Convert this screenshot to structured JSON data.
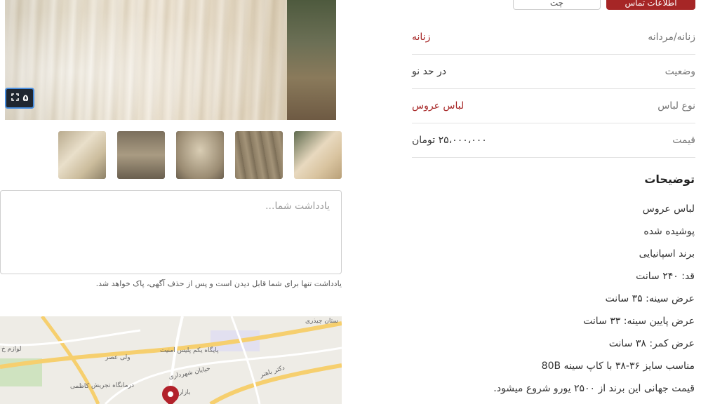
{
  "actions": {
    "chat_label": "چت",
    "contact_label": "اطلاعات تماس"
  },
  "gallery": {
    "photo_count": "۵",
    "main_image_icon": "expand-icon",
    "thumbnails": [
      "thumb-1",
      "thumb-2",
      "thumb-3",
      "thumb-4",
      "thumb-5"
    ]
  },
  "attributes": [
    {
      "key": "زنانه/مردانه",
      "value": "زنانه",
      "is_link": true
    },
    {
      "key": "وضعیت",
      "value": "در حد نو",
      "is_link": false
    },
    {
      "key": "نوع لباس",
      "value": "لباس عروس",
      "is_link": true
    },
    {
      "key": "قیمت",
      "value": "۲۵،۰۰۰،۰۰۰ تومان",
      "is_link": false
    }
  ],
  "description": {
    "title": "توضیحات",
    "lines": [
      "لباس عروس",
      "پوشیده شده",
      "برند اسپانیایی",
      "قد: ۲۴۰ سانت",
      "عرض سینه: ۳۵ سانت",
      "عرض پایین سینه: ۳۳ سانت",
      "عرض کمر: ۳۸ سانت",
      "مناسب سایز ۳۶-۳۸ با کاپ سینه 80B",
      "قیمت جهانی این برند از ۲۵۰۰ یورو شروع میشود."
    ]
  },
  "note": {
    "placeholder": "یادداشت شما...",
    "hint": "یادداشت تنها برای شما قابل دیدن است و پس از حذف آگهی، پاک خواهد شد."
  },
  "map": {
    "labels": [
      "ستان چیذری",
      "لوازم خ",
      "پایگاه یکم پلیس امنیت",
      "ولی عصر",
      "خیابان شهرداری",
      "دکتر باهنر",
      "درمانگاه تجریش",
      "کاظمی",
      "بازار"
    ],
    "colors": {
      "road": "#f6cf6e",
      "pin": "#b2222b",
      "park": "#cfe3c0"
    }
  },
  "colors": {
    "accent": "#a62626",
    "link_value": "#a62626"
  }
}
